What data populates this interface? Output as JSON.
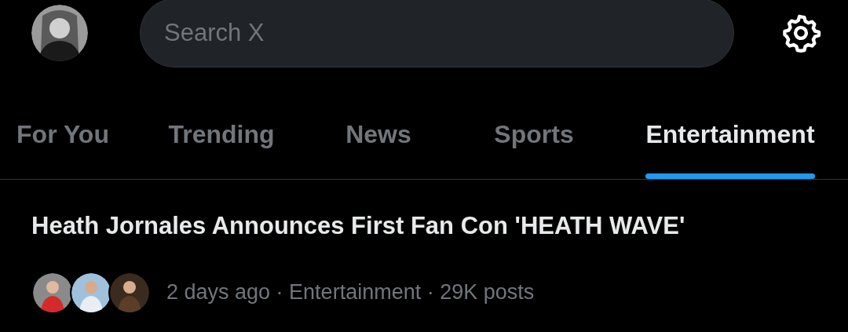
{
  "header": {
    "search": {
      "placeholder": "Search X"
    }
  },
  "tabs": [
    {
      "label": "For You",
      "selected": false
    },
    {
      "label": "Trending",
      "selected": false
    },
    {
      "label": "News",
      "selected": false
    },
    {
      "label": "Sports",
      "selected": false
    },
    {
      "label": "Entertainment",
      "selected": true
    }
  ],
  "trend": {
    "headline": "Heath Jornales Announces First Fan Con 'HEATH WAVE'",
    "meta": "2 days ago · Entertainment · 29K posts"
  }
}
